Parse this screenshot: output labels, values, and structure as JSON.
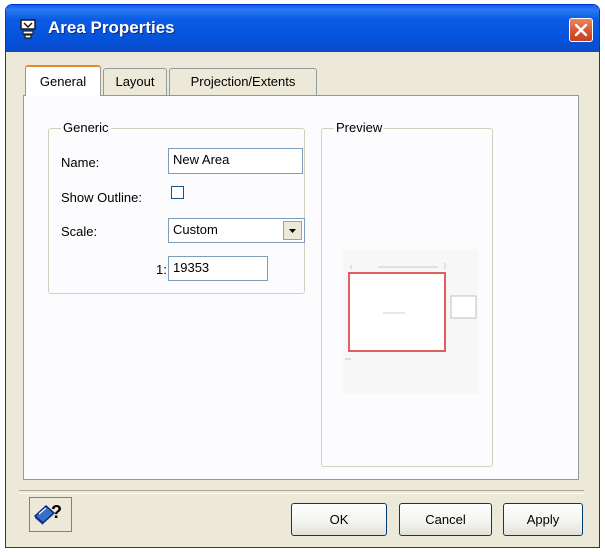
{
  "window": {
    "title": "Area Properties"
  },
  "tabs": [
    {
      "label": "General",
      "active": true
    },
    {
      "label": "Layout",
      "active": false
    },
    {
      "label": "Projection/Extents",
      "active": false
    }
  ],
  "generic": {
    "legend": "Generic",
    "name_label": "Name:",
    "name_value": "New Area",
    "show_outline_label": "Show Outline:",
    "show_outline_checked": false,
    "scale_label": "Scale:",
    "scale_value": "Custom",
    "ratio_prefix": "1:",
    "ratio_value": "19353"
  },
  "preview": {
    "legend": "Preview"
  },
  "buttons": {
    "ok": "OK",
    "cancel": "Cancel",
    "apply": "Apply"
  },
  "icons": {
    "title": "area-properties-icon",
    "close": "close-icon",
    "help": "context-help-icon",
    "dropdown": "chevron-down-icon"
  },
  "colors": {
    "titlebar": "#0453db",
    "close": "#d8522e",
    "active_tab_accent": "#e68b2c",
    "preview_frame": "#e06060"
  }
}
